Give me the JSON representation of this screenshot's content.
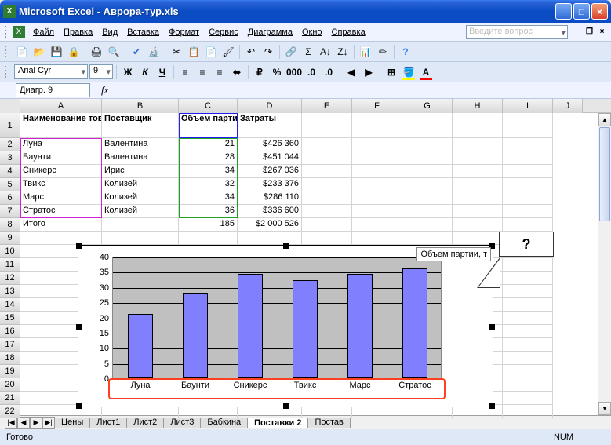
{
  "window": {
    "title": "Microsoft Excel - Аврора-тур.xls"
  },
  "menu": {
    "file": "Файл",
    "edit": "Правка",
    "view": "Вид",
    "insert": "Вставка",
    "format": "Формат",
    "tools": "Сервис",
    "diagram": "Диаграмма",
    "window": "Окно",
    "help": "Справка"
  },
  "ask_placeholder": "Введите вопрос",
  "font": {
    "name": "Arial Cyr",
    "size": "9"
  },
  "namebox": "Диагр. 9",
  "columns": [
    "A",
    "B",
    "C",
    "D",
    "E",
    "F",
    "G",
    "H",
    "I",
    "J"
  ],
  "table": {
    "headers": {
      "A": "Наименование товара",
      "B": "Поставщик",
      "C": "Объем партии, т",
      "D": "Затраты"
    },
    "rows": [
      {
        "A": "Луна",
        "B": "Валентина",
        "C": "21",
        "D": "$426 360"
      },
      {
        "A": "Баунти",
        "B": "Валентина",
        "C": "28",
        "D": "$451 044"
      },
      {
        "A": "Сникерс",
        "B": "Ирис",
        "C": "34",
        "D": "$267 036"
      },
      {
        "A": "Твикс",
        "B": "Колизей",
        "C": "32",
        "D": "$233 376"
      },
      {
        "A": "Марс",
        "B": "Колизей",
        "C": "34",
        "D": "$286 110"
      },
      {
        "A": "Стратос",
        "B": "Колизей",
        "C": "36",
        "D": "$336 600"
      }
    ],
    "total": {
      "A": "Итого",
      "C": "185",
      "D": "$2 000 526"
    }
  },
  "chart_data": {
    "type": "bar",
    "categories": [
      "Луна",
      "Баунти",
      "Сникерс",
      "Твикс",
      "Марс",
      "Стратос"
    ],
    "values": [
      21,
      28,
      34,
      32,
      34,
      36
    ],
    "title": "",
    "legend": "Объем партии, т",
    "ylim": [
      0,
      40
    ],
    "yticks": [
      0,
      5,
      10,
      15,
      20,
      25,
      30,
      35,
      40
    ]
  },
  "callout": "?",
  "sheets": [
    "Цены",
    "Лист1",
    "Лист2",
    "Лист3",
    "Бабкина",
    "Поставки 2",
    "Постав"
  ],
  "active_sheet": 5,
  "status": {
    "ready": "Готово",
    "num": "NUM"
  }
}
